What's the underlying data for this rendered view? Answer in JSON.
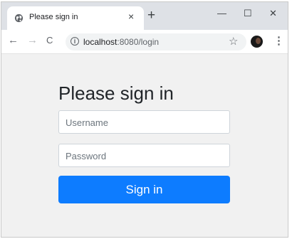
{
  "browser": {
    "tab": {
      "title": "Please sign in",
      "close": "×",
      "favicon": "globe-icon"
    },
    "new_tab": "+",
    "window_controls": {
      "minimize": "—",
      "maximize": "☐",
      "close": "✕"
    },
    "nav": {
      "back": "←",
      "forward": "→",
      "reload": "C"
    },
    "url": {
      "host": "localhost",
      "rest": ":8080/login"
    },
    "star": "☆",
    "menu": "⋮"
  },
  "form": {
    "heading": "Please sign in",
    "username_placeholder": "Username",
    "password_placeholder": "Password",
    "submit_label": "Sign in"
  },
  "colors": {
    "primary": "#0d7cff",
    "page_bg": "#f1f1f1",
    "tabbar_bg": "#dee1e6"
  }
}
